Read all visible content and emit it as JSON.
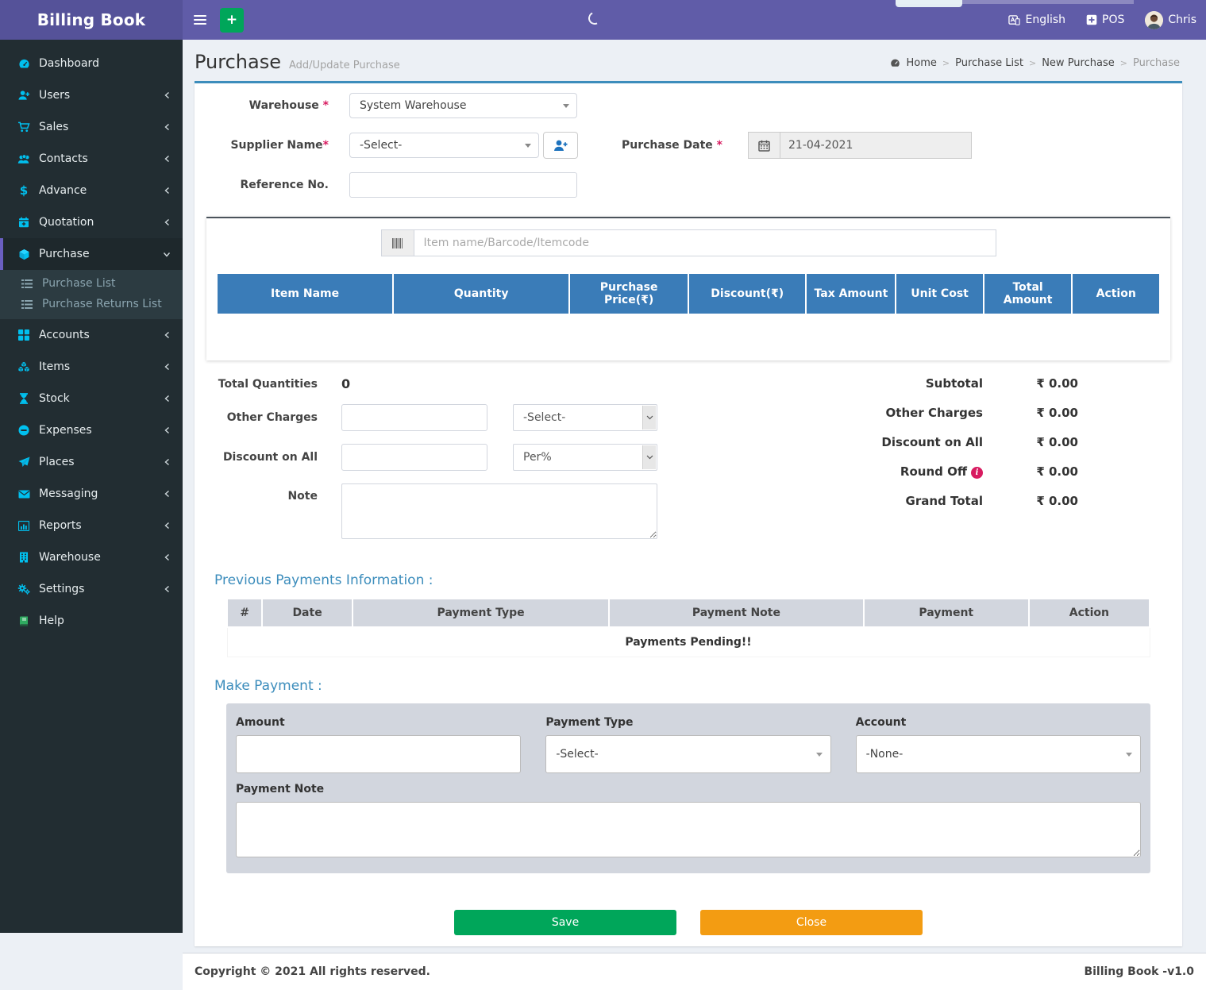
{
  "app": {
    "title": "Billing Book",
    "version_label": "Billing Book -v1.0",
    "copyright": "Copyright © 2021 All rights reserved."
  },
  "header": {
    "language_label": "English",
    "pos_label": "POS",
    "user_name": "Chris",
    "colors": {
      "bar": "#605ca8",
      "logo_bg": "#555299",
      "add_button": "#00a65a"
    }
  },
  "sidebar": {
    "items": [
      {
        "label": "Dashboard"
      },
      {
        "label": "Users"
      },
      {
        "label": "Sales"
      },
      {
        "label": "Contacts"
      },
      {
        "label": "Advance"
      },
      {
        "label": "Quotation"
      },
      {
        "label": "Purchase",
        "active": true,
        "children": [
          {
            "label": "Purchase List"
          },
          {
            "label": "Purchase Returns List"
          }
        ]
      },
      {
        "label": "Accounts"
      },
      {
        "label": "Items"
      },
      {
        "label": "Stock"
      },
      {
        "label": "Expenses"
      },
      {
        "label": "Places"
      },
      {
        "label": "Messaging"
      },
      {
        "label": "Reports"
      },
      {
        "label": "Warehouse"
      },
      {
        "label": "Settings"
      },
      {
        "label": "Help"
      }
    ],
    "colors": {
      "bg": "#222d32",
      "submenu_bg": "#2c3b41",
      "icon": "#00c0ef",
      "active_border": "#6a5fc1"
    }
  },
  "page": {
    "title": "Purchase",
    "subtitle": "Add/Update Purchase",
    "breadcrumb": [
      "Home",
      "Purchase List",
      "New Purchase",
      "Purchase"
    ]
  },
  "form": {
    "warehouse_label": "Warehouse",
    "warehouse_value": "System Warehouse",
    "supplier_label": "Supplier Name",
    "supplier_value": "-Select-",
    "purchase_date_label": "Purchase Date",
    "purchase_date_value": "21-04-2021",
    "reference_label": "Reference No.",
    "reference_value": "",
    "item_search_placeholder": "Item name/Barcode/Itemcode"
  },
  "items_table": {
    "columns": [
      "Item Name",
      "Quantity",
      "Purchase Price(₹)",
      "Discount(₹)",
      "Tax Amount",
      "Unit Cost",
      "Total Amount",
      "Action"
    ],
    "rows": []
  },
  "totals_left": {
    "total_quantities_label": "Total Quantities",
    "total_quantities_value": "0",
    "other_charges_label": "Other Charges",
    "other_charges_select": "-Select-",
    "discount_label": "Discount on All",
    "discount_select": "Per%",
    "note_label": "Note"
  },
  "totals_right": {
    "rows": [
      {
        "label": "Subtotal",
        "value": "₹ 0.00"
      },
      {
        "label": "Other Charges",
        "value": "₹ 0.00"
      },
      {
        "label": "Discount on All",
        "value": "₹ 0.00"
      },
      {
        "label": "Round Off",
        "value": "₹ 0.00",
        "info": "i"
      },
      {
        "label": "Grand Total",
        "value": "₹ 0.00"
      }
    ]
  },
  "payments": {
    "section_title": "Previous Payments Information :",
    "columns": [
      "#",
      "Date",
      "Payment Type",
      "Payment Note",
      "Payment",
      "Action"
    ],
    "empty_message": "Payments Pending!!"
  },
  "make_payment": {
    "section_title": "Make Payment :",
    "amount_label": "Amount",
    "payment_type_label": "Payment Type",
    "payment_type_value": "-Select-",
    "account_label": "Account",
    "account_value": "-None-",
    "payment_note_label": "Payment Note"
  },
  "actions": {
    "save": "Save",
    "close": "Close"
  }
}
